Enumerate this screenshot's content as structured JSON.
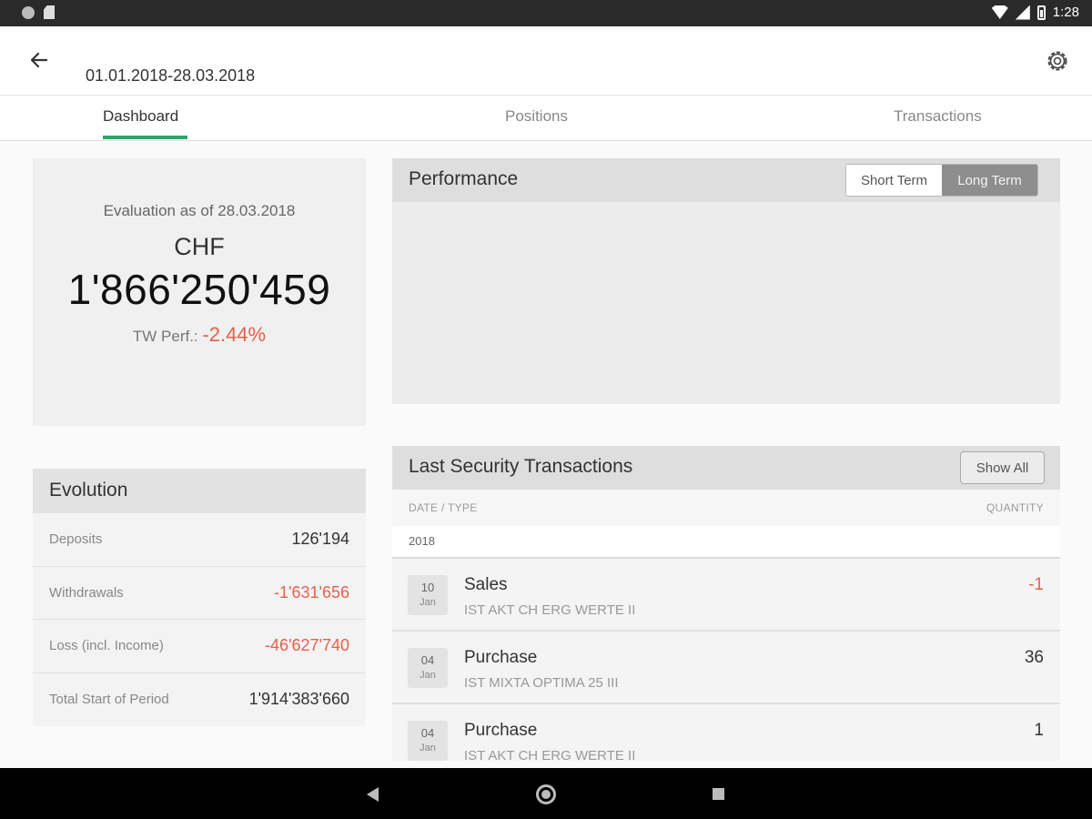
{
  "status_bar": {
    "time": "1:28"
  },
  "header": {
    "period": "01.01.2018-28.03.2018"
  },
  "tabs": [
    {
      "label": "Dashboard",
      "active": true
    },
    {
      "label": "Positions",
      "active": false
    },
    {
      "label": "Transactions",
      "active": false
    }
  ],
  "evaluation": {
    "title": "Evaluation as of 28.03.2018",
    "currency": "CHF",
    "value": "1'866'250'459",
    "perf_label": "TW Perf.:",
    "perf_value": "-2.44%"
  },
  "evolution": {
    "title": "Evolution",
    "rows": [
      {
        "label": "Deposits",
        "value": "126'194"
      },
      {
        "label": "Withdrawals",
        "value": "-1'631'656"
      },
      {
        "label": "Loss (incl. Income)",
        "value": "-46'627'740"
      },
      {
        "label": "Total Start of Period",
        "value": "1'914'383'660"
      }
    ]
  },
  "performance": {
    "title": "Performance",
    "short_term": "Short Term",
    "long_term": "Long Term",
    "selected": "Long Term"
  },
  "transactions": {
    "title": "Last Security Transactions",
    "show_all": "Show All",
    "col_date": "DATE / TYPE",
    "col_qty": "QUANTITY",
    "year": "2018",
    "items": [
      {
        "day": "10",
        "month": "Jan",
        "type": "Sales",
        "name": "IST AKT CH ERG WERTE II",
        "qty": "-1"
      },
      {
        "day": "04",
        "month": "Jan",
        "type": "Purchase",
        "name": "IST MIXTA OPTIMA 25 III",
        "qty": "36"
      },
      {
        "day": "04",
        "month": "Jan",
        "type": "Purchase",
        "name": "IST AKT CH ERG WERTE II",
        "qty": "1"
      }
    ]
  },
  "colors": {
    "accent": "#2aa86a",
    "negative": "#e8604a"
  }
}
